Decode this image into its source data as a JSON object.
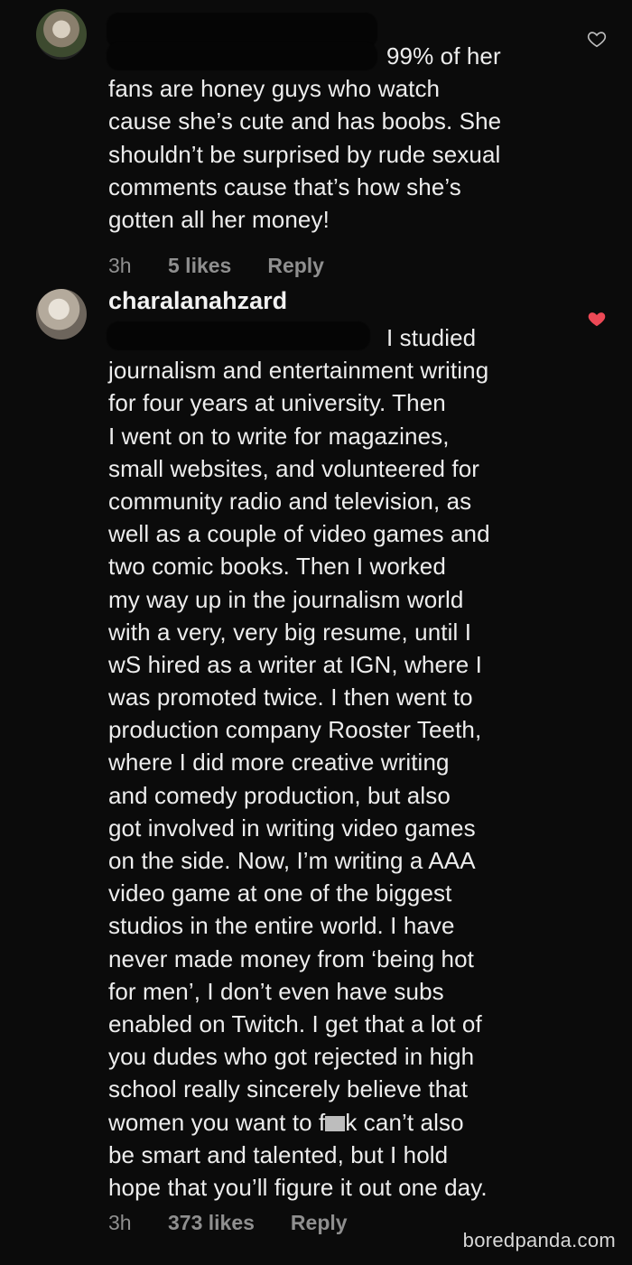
{
  "comments": [
    {
      "username": "",
      "lines": [
        "99% of her",
        "fans are honey guys who watch",
        "cause she’s cute and has boobs. She",
        "shouldn’t be surprised by rude sexual",
        "comments cause that’s how she’s",
        "gotten all her money!"
      ],
      "time": "3h",
      "likes": "5 likes",
      "reply": "Reply",
      "liked": false
    },
    {
      "username": "charalanahzard",
      "lines": [
        "I studied",
        "journalism and entertainment writing",
        "for four years at university.  Then",
        "I went on to write for magazines,",
        "small websites, and volunteered for",
        "community radio and television, as",
        "well as a couple of video games and",
        "two comic books. Then I worked",
        "my way up in the journalism world",
        "with a very, very big resume, until I",
        "wS hired as a writer at IGN, where I",
        "was promoted twice. I then went to",
        "production company Rooster Teeth,",
        "where I did more creative writing",
        "and comedy production, but also",
        "got involved in writing video games",
        "on the side. Now, I’m writing a AAA",
        "video game at one of the biggest",
        "studios in the entire world. I have",
        "never made money from ‘being hot",
        "for men’, I don’t even have subs",
        "enabled on Twitch. I get that a lot of",
        "you dudes who got rejected in high",
        "school really sincerely believe  that",
        "women you want to f",
        "be smart and talented, but I hold",
        "hope that you’ll figure it out one day."
      ],
      "censored_tail": "k can’t also",
      "time": "3h",
      "likes": "373 likes",
      "reply": "Reply",
      "liked": true
    }
  ],
  "watermark": "boredpanda.com",
  "colors": {
    "background": "#0b0b0b",
    "heart_liked": "#ed4956",
    "meta": "#8f8f8f"
  },
  "icons": {
    "heart_outline": "heart-outline-icon",
    "heart_filled": "heart-filled-icon"
  }
}
